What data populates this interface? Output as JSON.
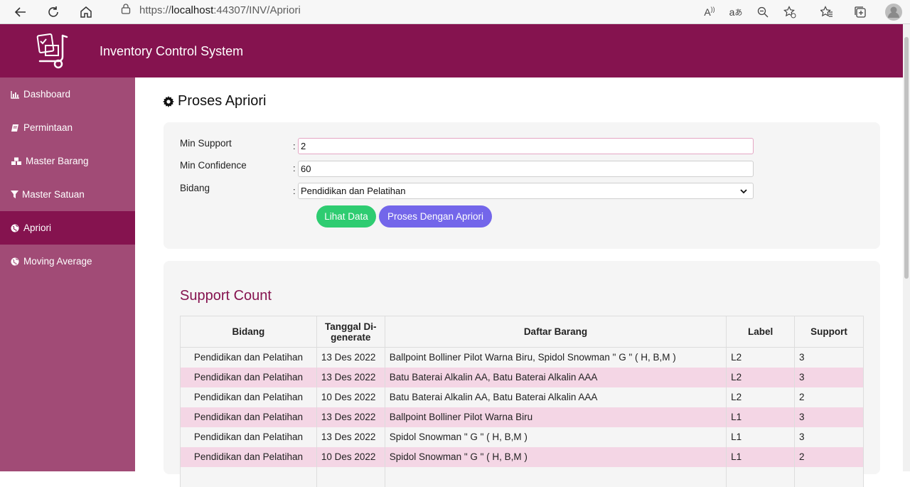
{
  "browser": {
    "url_prefix": "https://",
    "url_host": "localhost",
    "url_rest": ":44307/INV/Apriori",
    "icons": [
      "back-icon",
      "refresh-icon",
      "home-icon",
      "lock-icon",
      "read-aloud-icon",
      "translate-icon",
      "zoom-out-icon",
      "add-favorite-icon",
      "favorites-icon",
      "collections-icon",
      "profile-icon"
    ]
  },
  "header": {
    "title": "Inventory Control System"
  },
  "sidebar": {
    "items": [
      {
        "label": "Dashboard",
        "icon": "bar-chart-icon"
      },
      {
        "label": "Permintaan",
        "icon": "book-icon"
      },
      {
        "label": "Master Barang",
        "icon": "cubes-icon"
      },
      {
        "label": "Master Satuan",
        "icon": "filter-icon"
      },
      {
        "label": "Apriori",
        "icon": "globe-icon",
        "active": true
      },
      {
        "label": "Moving Average",
        "icon": "globe-icon"
      }
    ]
  },
  "page": {
    "title": "Proses Apriori"
  },
  "form": {
    "min_support_label": "Min Support",
    "min_support_value": "2",
    "min_confidence_label": "Min Confidence",
    "min_confidence_value": "60",
    "bidang_label": "Bidang",
    "bidang_value": "Pendidikan dan Pelatihan",
    "colon": ":",
    "btn_lihat": "Lihat Data",
    "btn_proses": "Proses Dengan Apriori"
  },
  "support": {
    "title": "Support Count",
    "headers": [
      "Bidang",
      "Tanggal Di-generate",
      "Daftar Barang",
      "Label",
      "Support"
    ],
    "rows": [
      [
        "Pendidikan dan Pelatihan",
        "13 Des 2022",
        "Ballpoint Bolliner Pilot Warna Biru, Spidol Snowman \" G \" ( H, B,M )",
        "L2",
        "3"
      ],
      [
        "Pendidikan dan Pelatihan",
        "13 Des 2022",
        "Batu Baterai Alkalin AA, Batu Baterai Alkalin AAA",
        "L2",
        "3"
      ],
      [
        "Pendidikan dan Pelatihan",
        "10 Des 2022",
        "Batu Baterai Alkalin AA, Batu Baterai Alkalin AAA",
        "L2",
        "2"
      ],
      [
        "Pendidikan dan Pelatihan",
        "13 Des 2022",
        "Ballpoint Bolliner Pilot Warna Biru",
        "L1",
        "3"
      ],
      [
        "Pendidikan dan Pelatihan",
        "13 Des 2022",
        "Spidol Snowman \" G \" ( H, B,M )",
        "L1",
        "3"
      ],
      [
        "Pendidikan dan Pelatihan",
        "10 Des 2022",
        "Spidol Snowman \" G \" ( H, B,M )",
        "L1",
        "2"
      ],
      [
        "",
        "",
        "",
        "",
        ""
      ]
    ]
  },
  "colors": {
    "primary": "#85134f",
    "sidebar": "#a14b76",
    "green": "#2ecc71",
    "purple": "#7366ea",
    "row_pink": "#f4d6e5"
  }
}
